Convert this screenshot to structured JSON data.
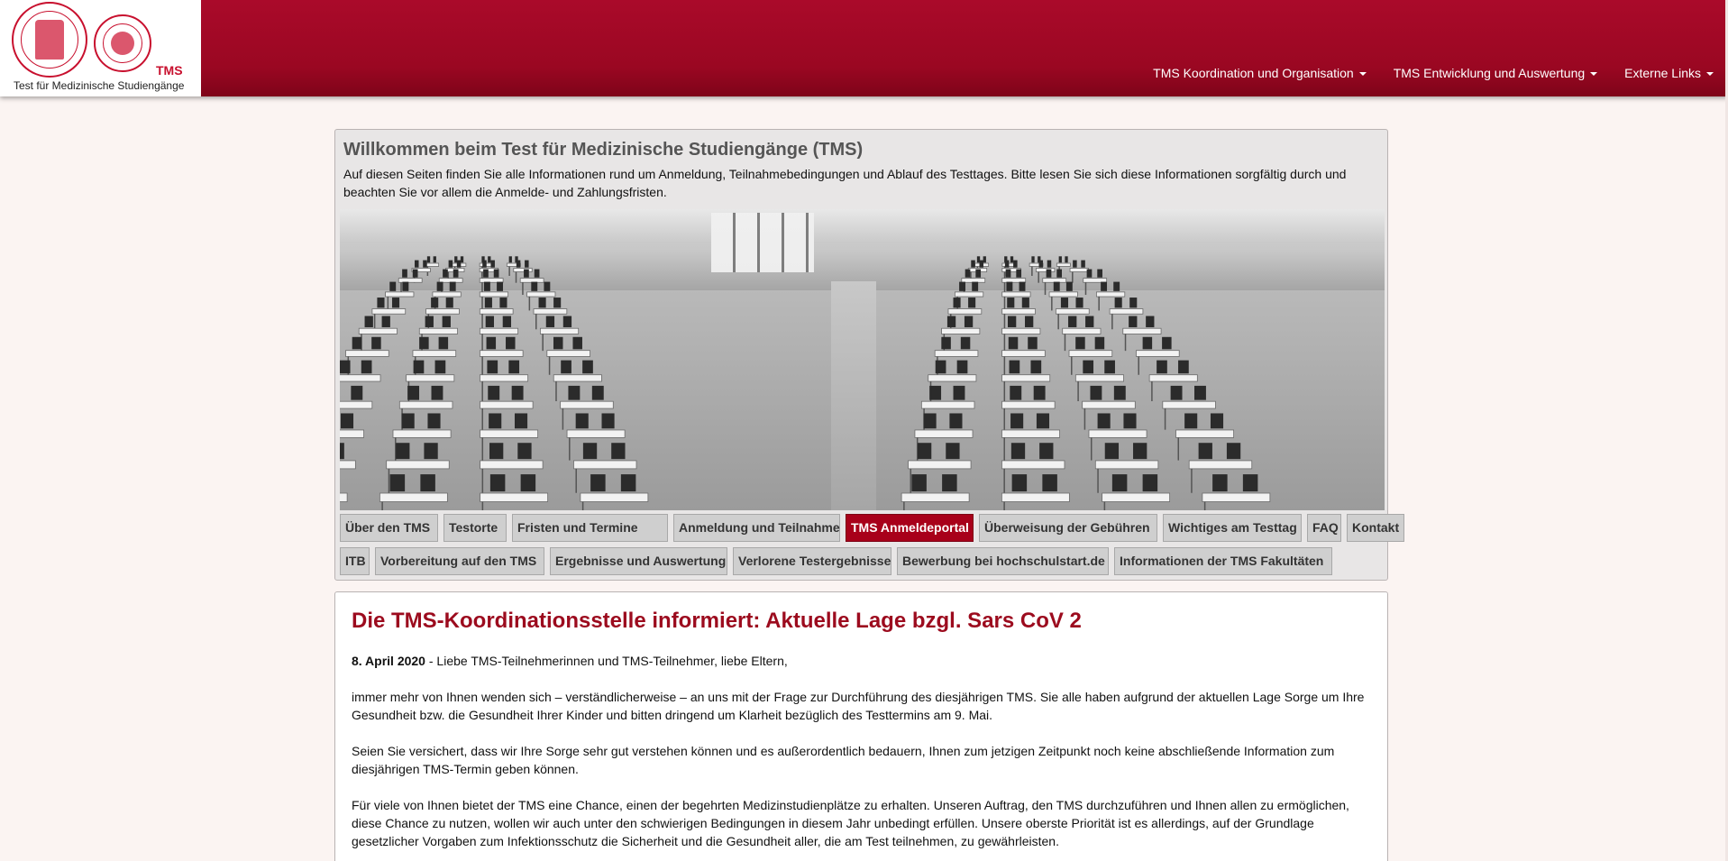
{
  "brand": {
    "logo_label": "TMS",
    "logo_text": "Test für Medizinische Studiengänge",
    "color_primary": "#9a0722",
    "color_active_tab": "#a8001a",
    "color_heading": "#9c0b1e"
  },
  "nav": {
    "items": [
      {
        "label": "TMS Koordination und Organisation"
      },
      {
        "label": "TMS Entwicklung und Auswertung"
      },
      {
        "label": "Externe Links"
      }
    ]
  },
  "welcome": {
    "title": "Willkommen beim Test für Medizinische Studiengänge (TMS)",
    "intro": "Auf diesen Seiten finden Sie alle Informationen rund um Anmeldung, Teilnahmebedingungen und Ablauf des Testtages. Bitte lesen Sie sich diese Informationen sorgfältig durch und beachten Sie vor allem die Anmelde- und Zahlungsfristen."
  },
  "tabs": {
    "row1": [
      {
        "label": "Über den TMS"
      },
      {
        "label": "Testorte"
      },
      {
        "label": "Fristen und Termine"
      },
      {
        "label": "Anmeldung und Teilnahme"
      },
      {
        "label": "TMS Anmeldeportal",
        "active": true
      },
      {
        "label": "Überweisung der Gebühren"
      },
      {
        "label": "Wichtiges am Testtag"
      },
      {
        "label": "FAQ"
      },
      {
        "label": "Kontakt"
      }
    ],
    "row2": [
      {
        "label": "ITB"
      },
      {
        "label": "Vorbereitung auf den TMS"
      },
      {
        "label": "Ergebnisse und Auswertung"
      },
      {
        "label": "Verlorene Testergebnisse"
      },
      {
        "label": "Bewerbung bei hochschulstart.de"
      },
      {
        "label": "Informationen der TMS Fakultäten"
      }
    ]
  },
  "news": {
    "title": "Die TMS-Koordinationsstelle informiert: Aktuelle Lage bzgl. Sars CoV 2",
    "date": "8. April 2020",
    "greeting": " - Liebe TMS-Teilnehmerinnen und TMS-Teilnehmer, liebe Eltern,",
    "p1": "immer mehr von Ihnen wenden sich – verständlicherweise –  an uns mit der Frage zur Durchführung des diesjährigen TMS. Sie alle haben aufgrund der aktuellen Lage Sorge um Ihre Gesundheit bzw. die Gesundheit Ihrer Kinder und bitten dringend um Klarheit bezüglich des Testtermins am 9. Mai.",
    "p2": "Seien Sie versichert, dass wir Ihre Sorge sehr gut verstehen können und es außerordentlich bedauern, Ihnen zum jetzigen Zeitpunkt noch keine abschließende Information zum diesjährigen TMS-Termin geben können.",
    "p3": "Für viele von Ihnen bietet der TMS eine Chance, einen der begehrten Medizinstudienplätze zu erhalten. Unseren Auftrag, den TMS durchzuführen und Ihnen allen zu ermöglichen, diese Chance zu nutzen, wollen wir auch unter den schwierigen Bedingungen in diesem Jahr unbedingt erfüllen. Unsere oberste Priorität ist es allerdings, auf der Grundlage gesetzlicher Vorgaben zum Infektionsschutz die Sicherheit und die Gesundheit aller, die am Test teilnehmen, zu gewährleisten."
  }
}
